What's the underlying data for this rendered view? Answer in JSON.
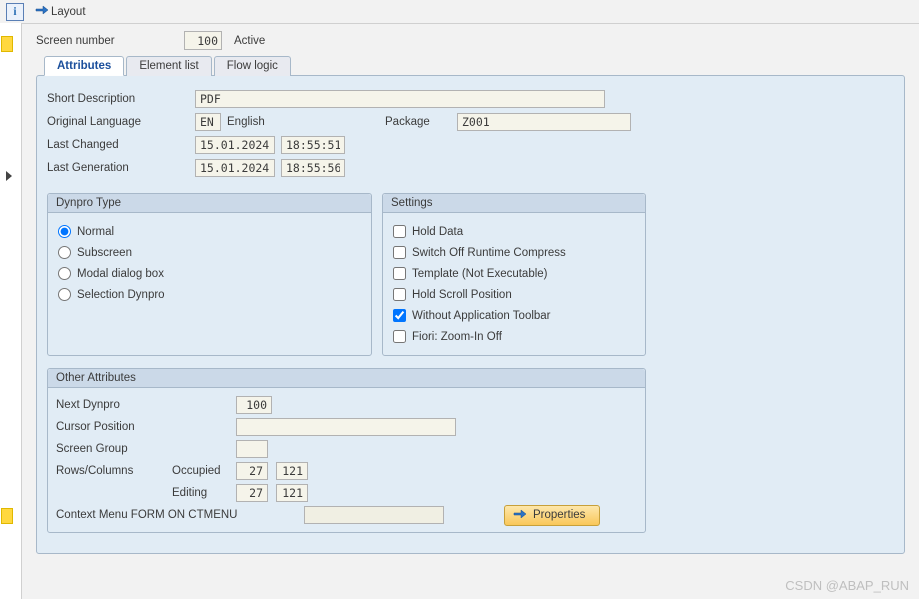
{
  "toolbar": {
    "layout_label": "Layout"
  },
  "screen": {
    "label": "Screen number",
    "number": "100",
    "status": "Active"
  },
  "tabs": {
    "attributes": "Attributes",
    "element_list": "Element list",
    "flow_logic": "Flow logic"
  },
  "attr": {
    "short_desc_label": "Short Description",
    "short_desc": "PDF",
    "orig_lang_label": "Original Language",
    "lang_code": "EN",
    "lang_name": "English",
    "package_label": "Package",
    "package": "Z001",
    "last_changed_label": "Last Changed",
    "last_changed_date": "15.01.2024",
    "last_changed_time": "18:55:51",
    "last_gen_label": "Last Generation",
    "last_gen_date": "15.01.2024",
    "last_gen_time": "18:55:56"
  },
  "dynpro": {
    "header": "Dynpro Type",
    "normal": "Normal",
    "subscreen": "Subscreen",
    "modal": "Modal dialog box",
    "sel": "Selection Dynpro"
  },
  "settings": {
    "header": "Settings",
    "hold": "Hold Data",
    "compress": "Switch Off Runtime Compress",
    "template": "Template (Not Executable)",
    "scroll": "Hold Scroll Position",
    "no_toolbar": "Without Application Toolbar",
    "fiori": "Fiori: Zoom-In Off"
  },
  "other": {
    "header": "Other Attributes",
    "next_dynpro_label": "Next Dynpro",
    "next_dynpro": "100",
    "cursor_label": "Cursor Position",
    "group_label": "Screen Group",
    "rowscols_label": "Rows/Columns",
    "occupied_label": "Occupied",
    "editing_label": "Editing",
    "occ_rows": "27",
    "occ_cols": "121",
    "edit_rows": "27",
    "edit_cols": "121",
    "ctxmenu_label": "Context Menu FORM ON CTMENU",
    "properties_btn": "Properties"
  },
  "watermark": "CSDN @ABAP_RUN"
}
